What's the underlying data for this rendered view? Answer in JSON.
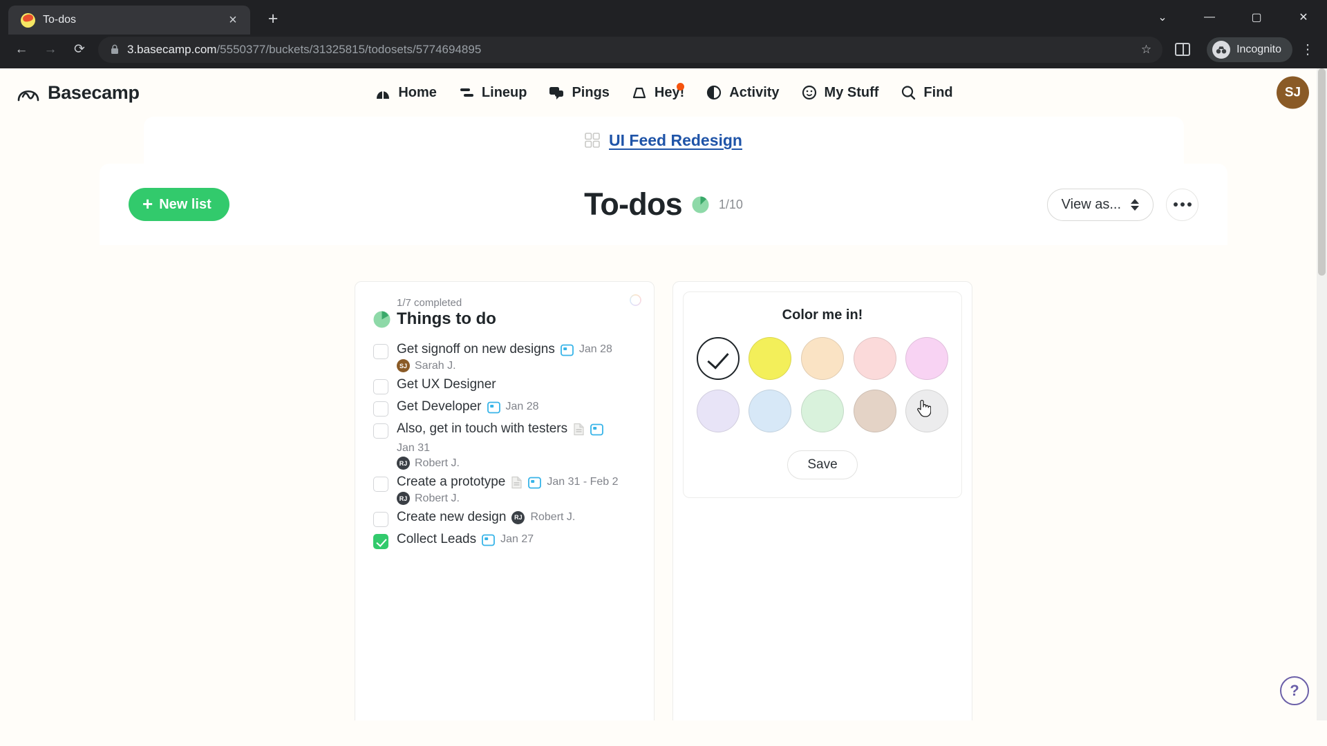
{
  "browser": {
    "tab": {
      "title": "To-dos",
      "favicon": "basecamp-favicon",
      "close_label": "×"
    },
    "new_tab_label": "+",
    "window_controls": {
      "minimize": "—",
      "maximize": "▢",
      "close": "✕",
      "collapse": "⌄"
    },
    "nav": {
      "back": "←",
      "forward": "→",
      "reload": "⟳"
    },
    "omnibox": {
      "url_domain": "3.basecamp.com",
      "url_path": "/5550377/buckets/31325815/todosets/5774694895",
      "lock": "lock-icon",
      "star": "☆"
    },
    "profile": {
      "label": "Incognito"
    },
    "menu": "⋮"
  },
  "app": {
    "brand": "Basecamp",
    "nav_items": [
      {
        "label": "Home",
        "icon": "home-icon"
      },
      {
        "label": "Lineup",
        "icon": "lineup-icon"
      },
      {
        "label": "Pings",
        "icon": "pings-icon"
      },
      {
        "label": "Hey!",
        "icon": "hey-icon",
        "badge": true
      },
      {
        "label": "Activity",
        "icon": "activity-icon"
      },
      {
        "label": "My Stuff",
        "icon": "my-stuff-icon"
      },
      {
        "label": "Find",
        "icon": "search-icon"
      }
    ],
    "avatar": {
      "initials": "SJ",
      "color": "#8a5a26"
    },
    "breadcrumb": {
      "label": "UI Feed Redesign",
      "icon": "grid-icon"
    },
    "header": {
      "new_list_label": "New list",
      "title": "To-dos",
      "progress_count": "1/10",
      "view_as_label": "View as...",
      "more_label": "•••"
    },
    "list_card": {
      "completed_meta": "1/7 completed",
      "title": "Things to do",
      "items": [
        {
          "text": "Get signoff on new designs",
          "done": false,
          "has_doc": false,
          "date": "Jan 28",
          "assignee": {
            "initials": "SJ",
            "name": "Sarah J.",
            "color": "#8a5a26"
          }
        },
        {
          "text": "Get UX Designer",
          "done": false,
          "has_doc": false,
          "date": "",
          "assignee": null
        },
        {
          "text": "Get Developer",
          "done": false,
          "has_doc": false,
          "date": "Jan 28",
          "assignee": null
        },
        {
          "text": "Also, get in touch with testers",
          "done": false,
          "has_doc": true,
          "date": "Jan 31",
          "assignee": {
            "initials": "RJ",
            "name": "Robert J.",
            "color": "#3a3f45"
          }
        },
        {
          "text": "Create a prototype",
          "done": false,
          "has_doc": true,
          "date": "Jan 31 - Feb 2",
          "assignee": {
            "initials": "RJ",
            "name": "Robert J.",
            "color": "#3a3f45"
          }
        },
        {
          "text": "Create new design",
          "done": false,
          "has_doc": false,
          "date": "",
          "assignee": {
            "initials": "RJ",
            "name": "Robert J.",
            "color": "#3a3f45"
          }
        },
        {
          "text": "Collect Leads",
          "done": true,
          "has_doc": false,
          "date": "Jan 27",
          "assignee": null
        }
      ]
    },
    "color_card": {
      "title": "Color me in!",
      "save_label": "Save",
      "swatches": [
        {
          "name": "white",
          "hex": "#ffffff",
          "selected": true
        },
        {
          "name": "yellow",
          "hex": "#f3ef5a",
          "selected": false
        },
        {
          "name": "peach",
          "hex": "#fae3c4",
          "selected": false
        },
        {
          "name": "pink",
          "hex": "#fbdada",
          "selected": false
        },
        {
          "name": "magenta",
          "hex": "#f8d3f3",
          "selected": false
        },
        {
          "name": "lavender",
          "hex": "#e8e4f7",
          "selected": false
        },
        {
          "name": "light-blue",
          "hex": "#d7e8f7",
          "selected": false
        },
        {
          "name": "light-green",
          "hex": "#d9f2dc",
          "selected": false
        },
        {
          "name": "tan",
          "hex": "#e4d3c6",
          "selected": false
        },
        {
          "name": "light-gray",
          "hex": "#ececed",
          "selected": false,
          "cursor": true
        }
      ]
    },
    "help_label": "?"
  }
}
